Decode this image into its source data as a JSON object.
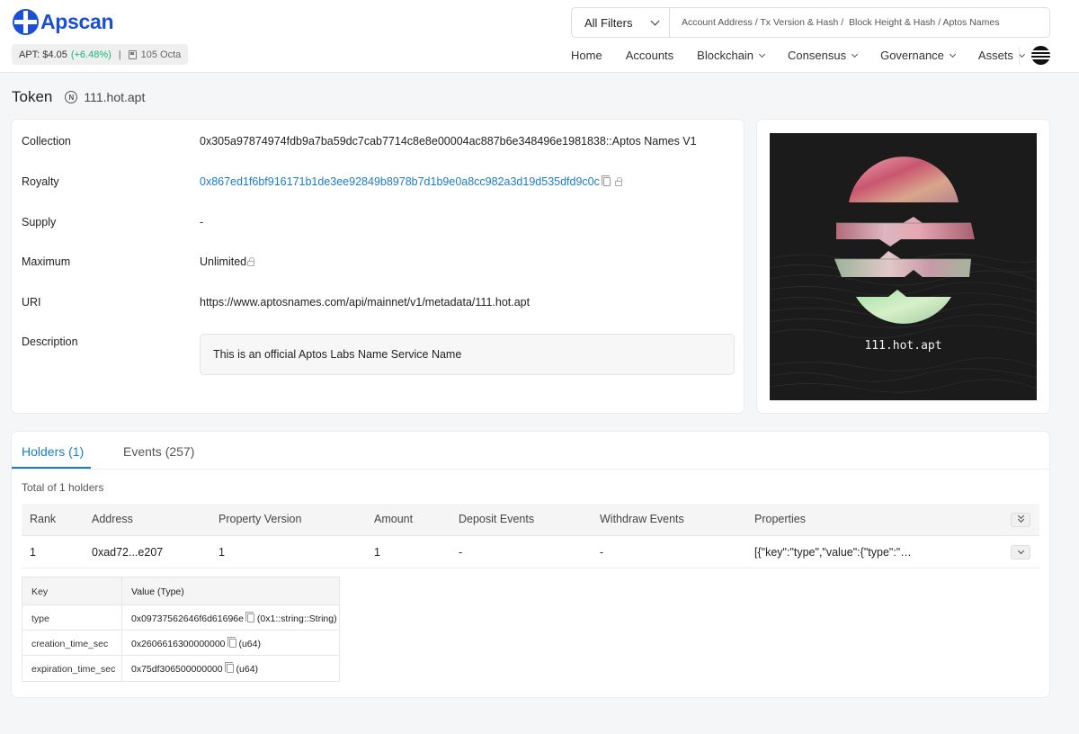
{
  "header": {
    "logo_text": "Apscan",
    "price_label": "APT: $4.05",
    "price_change": "(+6.48%)",
    "gas_label": "105 Octa",
    "filter_label": "All Filters",
    "search_placeholder": "Account Address / Tx Version & Hash /  Block Height & Hash / Aptos Names",
    "nav": [
      "Home",
      "Accounts",
      "Blockchain",
      "Consensus",
      "Governance",
      "Assets"
    ]
  },
  "page": {
    "title": "Token",
    "token_name": "111.hot.apt"
  },
  "info": {
    "collection_label": "Collection",
    "collection_value": "0x305a97874974fdb9a7ba59dc7cab7714c8e8e00004ac887b6e348496e1981838::Aptos Names V1",
    "royalty_label": "Royalty",
    "royalty_value": "0x867ed1f6bf916171b1de3ee92849b8978b7d1b9e0a8cc982a3d19d535dfd9c0c",
    "supply_label": "Supply",
    "supply_value": "-",
    "maximum_label": "Maximum",
    "maximum_value": "Unlimited",
    "uri_label": "URI",
    "uri_value": "https://www.aptosnames.com/api/mainnet/v1/metadata/111.hot.apt",
    "description_label": "Description",
    "description_value": "This is an official Aptos Labs Name Service Name"
  },
  "nft_image": {
    "label": "111.hot.apt"
  },
  "tabs": [
    {
      "label": "Holders (1)"
    },
    {
      "label": "Events (257)"
    }
  ],
  "holders": {
    "total": "Total of 1 holders",
    "columns": [
      "Rank",
      "Address",
      "Property Version",
      "Amount",
      "Deposit Events",
      "Withdraw Events",
      "Properties"
    ],
    "rows": [
      {
        "rank": "1",
        "address": "0xad72...e207",
        "property_version": "1",
        "amount": "1",
        "deposit_events": "-",
        "withdraw_events": "-",
        "properties": "[{\"key\":\"type\",\"value\":{\"type\":\"…"
      }
    ]
  },
  "properties_table": {
    "key_header": "Key",
    "value_header": "Value (Type)",
    "rows": [
      {
        "key": "type",
        "value": "0x09737562646f6d61696e",
        "type": "(0x1::string::String)"
      },
      {
        "key": "creation_time_sec",
        "value": "0x2606616300000000",
        "type": "(u64)"
      },
      {
        "key": "expiration_time_sec",
        "value": "0x75df306500000000",
        "type": "(u64)"
      }
    ]
  }
}
